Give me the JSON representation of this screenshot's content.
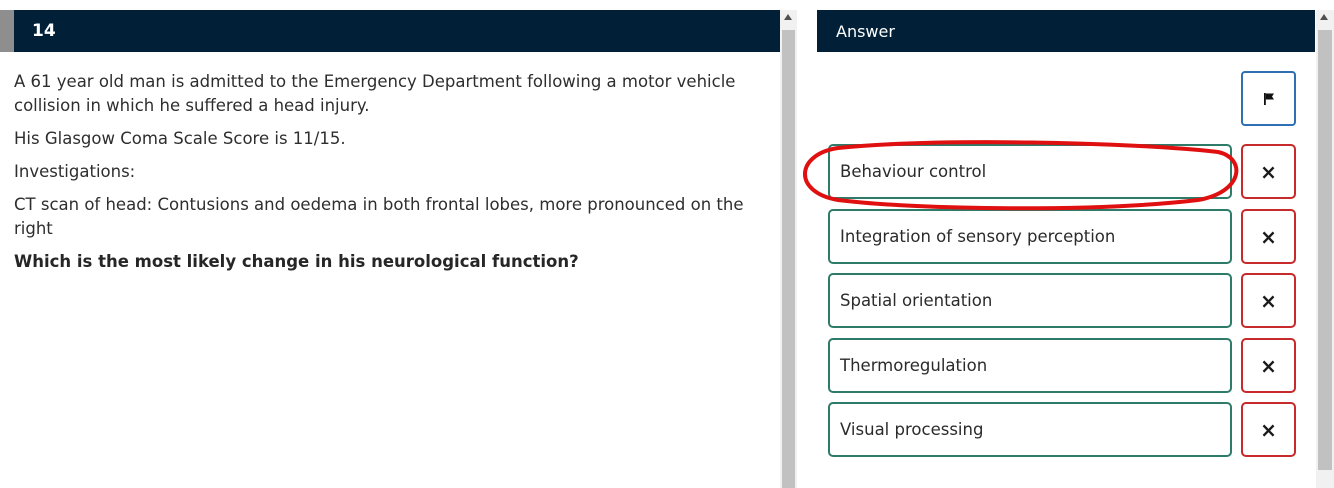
{
  "question": {
    "number": "14",
    "paragraphs": [
      "A 61 year old man is admitted to the Emergency Department following a motor vehicle collision in which he suffered a head injury.",
      "His Glasgow Coma Scale Score is 11/15.",
      "Investigations:",
      "CT scan of head: Contusions and oedema in both frontal lobes, more pronounced on the right"
    ],
    "prompt": "Which is the most likely change in his neurological function?"
  },
  "answer_panel": {
    "title": "Answer",
    "flag_icon": "flag-icon",
    "strike_icon": "×",
    "options": [
      {
        "label": "Behaviour control"
      },
      {
        "label": "Integration of sensory perception"
      },
      {
        "label": "Spatial orientation"
      },
      {
        "label": "Thermoregulation"
      },
      {
        "label": "Visual processing"
      }
    ]
  },
  "colors": {
    "header_bg": "#012037",
    "option_border": "#2f7b6a",
    "strike_border": "#c62a2a",
    "flag_border": "#2f6fb4",
    "annotation": "#e01010"
  }
}
